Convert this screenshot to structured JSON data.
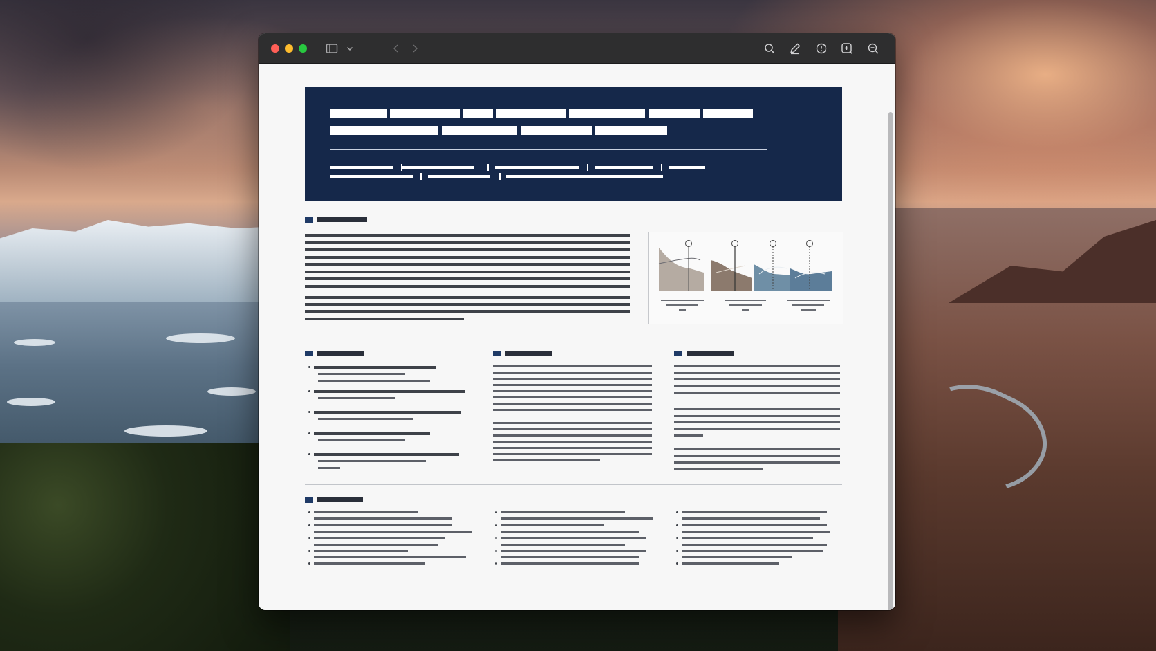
{
  "window": {
    "titlebar_icons": [
      "sidebar-icon",
      "chevron-down-icon",
      "back-arrow-icon",
      "forward-arrow-icon",
      "search-icon",
      "markup-pen-icon",
      "info-icon",
      "zoom-in-icon",
      "zoom-out-icon"
    ]
  },
  "colors": {
    "banner": "#15284a",
    "section_marker": "#1f3a66",
    "titlebar": "#2e2e2f",
    "close": "#ff5f57",
    "minimize": "#febc2e",
    "zoom": "#28c840"
  },
  "document": {
    "note": "",
    "figure_panels": [
      "panel-1",
      "panel-2",
      "panel-3",
      "panel-4"
    ]
  }
}
